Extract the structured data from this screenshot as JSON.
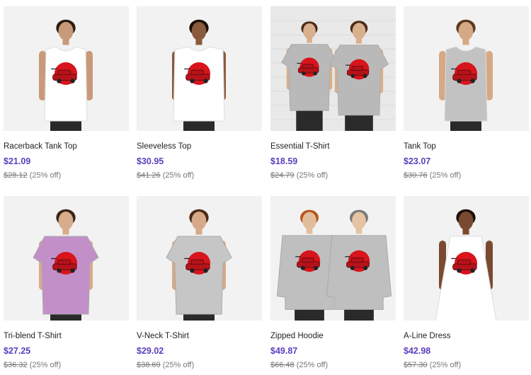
{
  "products": [
    {
      "title": "Racerback Tank Top",
      "price": "$21.09",
      "old_price": "$28.12",
      "discount": "(25% off)",
      "garment": "racerback-tank",
      "color": "#ffffff",
      "skin": "#c99a7a",
      "hair": "#2a1a12"
    },
    {
      "title": "Sleeveless Top",
      "price": "$30.95",
      "old_price": "$41.26",
      "discount": "(25% off)",
      "garment": "sleeveless-top",
      "color": "#ffffff",
      "skin": "#8a5a3c",
      "hair": "#1a1008"
    },
    {
      "title": "Essential T-Shirt",
      "price": "$18.59",
      "old_price": "$24.79",
      "discount": "(25% off)",
      "garment": "tshirt-back-pair",
      "color": "#b9b9b9",
      "skin": "#d9b08c",
      "hair": "#4a2a18"
    },
    {
      "title": "Tank Top",
      "price": "$23.07",
      "old_price": "$30.76",
      "discount": "(25% off)",
      "garment": "tank-back",
      "color": "#c2c2c2",
      "skin": "#d6a985",
      "hair": "#5a3a22"
    },
    {
      "title": "Tri-blend T-Shirt",
      "price": "$27.25",
      "old_price": "$36.32",
      "discount": "(25% off)",
      "garment": "tshirt-front",
      "color": "#c28fc9",
      "skin": "#d7ab8b",
      "hair": "#3a2216"
    },
    {
      "title": "V-Neck T-Shirt",
      "price": "$29.02",
      "old_price": "$38.69",
      "discount": "(25% off)",
      "garment": "tshirt-back",
      "color": "#c6c6c6",
      "skin": "#d6aa88",
      "hair": "#4a2a16"
    },
    {
      "title": "Zipped Hoodie",
      "price": "$49.87",
      "old_price": "$66.48",
      "discount": "(25% off)",
      "garment": "hoodie-pair",
      "color": "#bfbfbf",
      "skin": "#e2bd9c",
      "hair": "#b8551e"
    },
    {
      "title": "A-Line Dress",
      "price": "$42.98",
      "old_price": "$57.30",
      "discount": "(25% off)",
      "garment": "aline-dress",
      "color": "#ffffff",
      "skin": "#7a4a30",
      "hair": "#1a0f08"
    }
  ],
  "colors": {
    "price": "#5b3fbf",
    "title": "#222222",
    "old_price": "#777777",
    "background": "#ffffff",
    "thumb_bg": "#f2f2f2",
    "design_sun": "#d8141c",
    "design_car": "#b5121a"
  },
  "icons": {
    "design": "red-sun-car-print-icon"
  }
}
